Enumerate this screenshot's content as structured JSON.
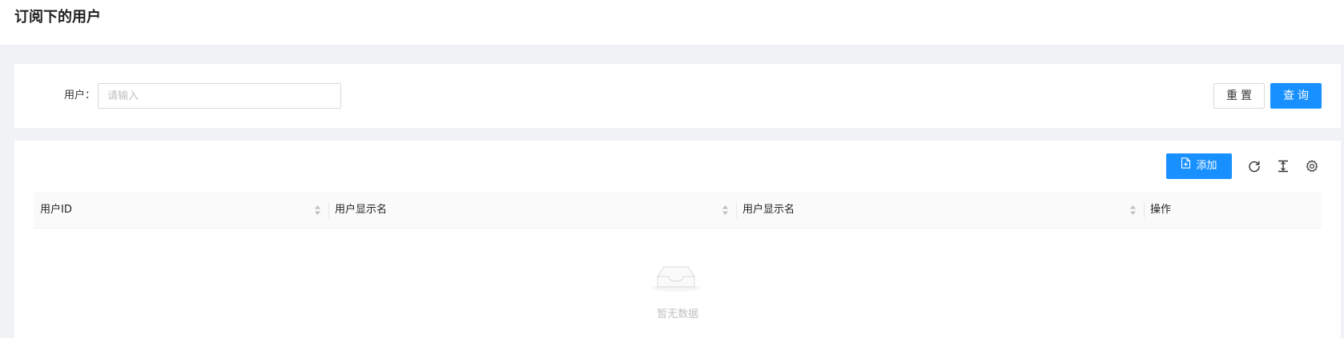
{
  "header": {
    "title": "订阅下的用户"
  },
  "search": {
    "user_label": "用户",
    "user_placeholder": "请输入",
    "user_value": "",
    "reset_label": "重置",
    "query_label": "查询"
  },
  "toolbar": {
    "add_label": "添加",
    "icons": [
      "reload-icon",
      "column-height-icon",
      "setting-icon"
    ]
  },
  "table": {
    "columns": [
      {
        "label": "用户ID",
        "sortable": true
      },
      {
        "label": "用户显示名",
        "sortable": true
      },
      {
        "label": "用户显示名",
        "sortable": true
      },
      {
        "label": "操作",
        "sortable": false
      }
    ],
    "empty_text": "暂无数据"
  },
  "colors": {
    "primary": "#1890ff",
    "background": "#f0f2f5",
    "table_header_bg": "#fafafa"
  }
}
